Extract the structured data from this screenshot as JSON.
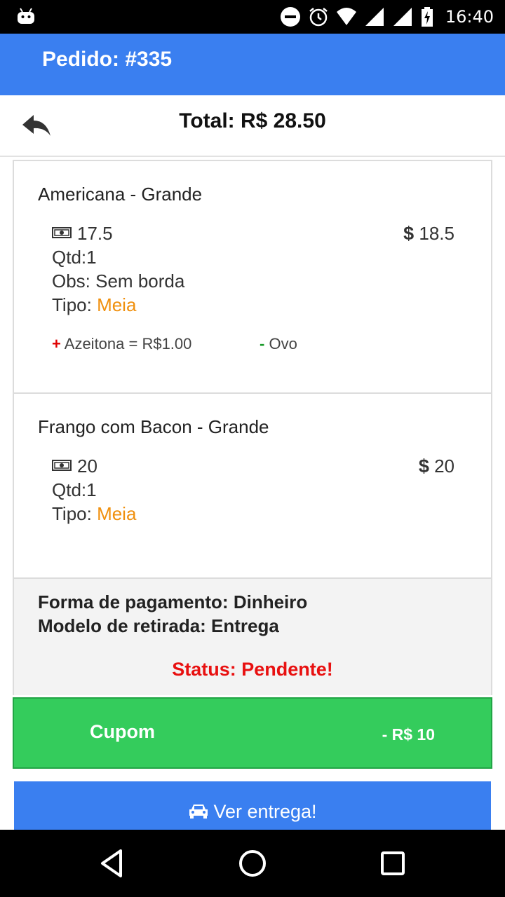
{
  "status_bar": {
    "time": "16:40",
    "icons": [
      "android-icon",
      "do-not-disturb-icon",
      "alarm-icon",
      "wifi-icon",
      "signal-icon",
      "signal-icon",
      "battery-charging-icon"
    ]
  },
  "app_bar": {
    "title": "Pedido: #335"
  },
  "header": {
    "back_icon": "reply-arrow-icon",
    "total": "Total: R$ 28.50"
  },
  "items": [
    {
      "name": "Americana - Grande",
      "unit_price": "17.5",
      "total_price": "18.5",
      "qty": "Qtd:1",
      "obs": "Obs: Sem borda",
      "tipo_label": "Tipo: ",
      "tipo_value": "Meia",
      "extra_add_sign": "+",
      "extra_add": "Azeitona = R$1.00",
      "extra_remove_sign": "-",
      "extra_remove": "Ovo"
    },
    {
      "name": "Frango com Bacon - Grande",
      "unit_price": "20",
      "total_price": "20",
      "qty": "Qtd:1",
      "tipo_label": "Tipo: ",
      "tipo_value": "Meia"
    }
  ],
  "info": {
    "payment": "Forma de pagamento: Dinheiro",
    "pickup": "Modelo de retirada: Entrega",
    "status": "Status: Pendente!"
  },
  "coupon": {
    "label": "Cupom",
    "value": "- R$ 10"
  },
  "delivery_button": {
    "label": "Ver entrega!",
    "icon": "car-icon"
  },
  "currency_symbol": "$",
  "colors": {
    "primary": "#3a7ff0",
    "coupon_green": "#34cc5c",
    "status_red": "#e81010",
    "tipo_orange": "#f0900e",
    "add_red": "#e00000",
    "remove_green": "#1a9a2a"
  }
}
